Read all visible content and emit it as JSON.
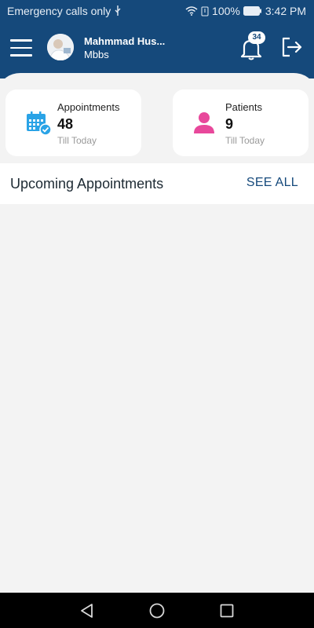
{
  "status_bar": {
    "carrier_text": "Emergency calls only",
    "battery": "100%",
    "time": "3:42 PM"
  },
  "header": {
    "user_name": "Mahmmad Hus...",
    "user_role": "Mbbs",
    "notification_count": "34"
  },
  "cards": [
    {
      "title": "Appointments",
      "count": "48",
      "subtitle": "Till Today"
    },
    {
      "title": "Patients",
      "count": "9",
      "subtitle": "Till Today"
    }
  ],
  "upcoming": {
    "title": "Upcoming Appointments",
    "see_all_label": "SEE ALL"
  },
  "colors": {
    "primary": "#15497b",
    "calendar_icon": "#2aa3e6",
    "patient_icon": "#e8489b",
    "background": "#f3f3f3"
  }
}
